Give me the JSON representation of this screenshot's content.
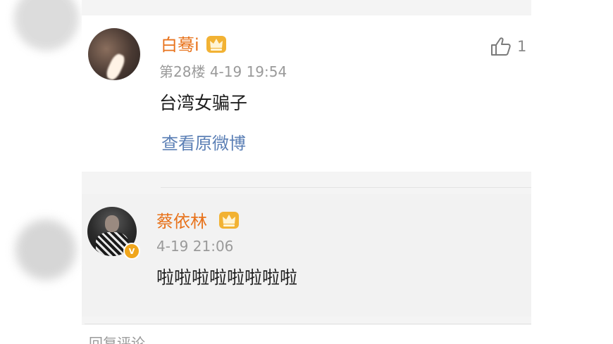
{
  "comments": [
    {
      "username": "白蓦i",
      "floor": "第28楼",
      "date": "4-19",
      "time": "19:54",
      "text": "台湾女骗子",
      "like_count": "1",
      "view_original": "查看原微博"
    },
    {
      "username": "蔡依林",
      "date": "4-19",
      "time": "21:06",
      "text": "啦啦啦啦啦啦啦啦",
      "verified_badge": "V"
    }
  ],
  "footer": {
    "text": "回复评论"
  },
  "colors": {
    "username": "#e8731c",
    "meta": "#9a9a9a",
    "link": "#5b7fb5",
    "text": "#1e1e1e",
    "crown": "#f2b233",
    "verified": "#f0a61c"
  },
  "icons": {
    "like": "thumbs-up-icon",
    "crown": "vip-crown-icon"
  }
}
